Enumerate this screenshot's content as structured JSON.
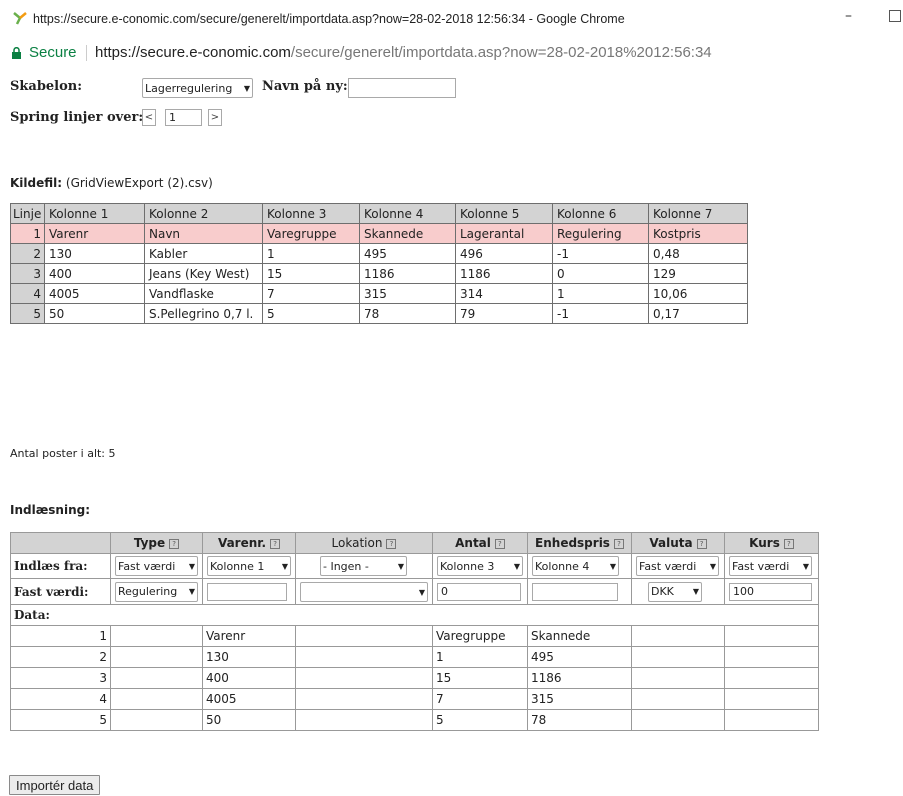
{
  "window": {
    "title": "https://secure.e-conomic.com/secure/generelt/importdata.asp?now=28-02-2018 12:56:34 - Google Chrome",
    "minimize": "–"
  },
  "address": {
    "secure_label": "Secure",
    "url_host": "https://secure.e-conomic.com",
    "url_path": "/secure/generelt/importdata.asp?now=28-02-2018%2012:56:34"
  },
  "form": {
    "template_label": "Skabelon:",
    "template_value": "Lagerregulering",
    "new_name_label": "Navn på ny:",
    "new_name_value": "",
    "skip_label": "Spring linjer over:",
    "skip_prev": "<",
    "skip_value": "1",
    "skip_next": ">"
  },
  "source": {
    "label": "Kildefil:",
    "filename": "(GridViewExport (2).csv)",
    "headers": [
      "Linje",
      "Kolonne 1",
      "Kolonne 2",
      "Kolonne 3",
      "Kolonne 4",
      "Kolonne 5",
      "Kolonne 6",
      "Kolonne 7"
    ],
    "rows": [
      [
        "1",
        "Varenr",
        "Navn",
        "Varegruppe",
        "Skannede",
        "Lagerantal",
        "Regulering",
        "Kostpris"
      ],
      [
        "2",
        "130",
        "Kabler",
        "1",
        "495",
        "496",
        "-1",
        "0,48"
      ],
      [
        "3",
        "400",
        "Jeans (Key West)",
        "15",
        "1186",
        "1186",
        "0",
        "129"
      ],
      [
        "4",
        "4005",
        "Vandflaske",
        "7",
        "315",
        "314",
        "1",
        "10,06"
      ],
      [
        "5",
        "50",
        "S.Pellegrino 0,7 l.",
        "5",
        "78",
        "79",
        "-1",
        "0,17"
      ]
    ],
    "total": "Antal poster i alt: 5"
  },
  "import": {
    "title": "Indlæsning:",
    "headers": [
      "Type",
      "Varenr.",
      "Lokation",
      "Antal",
      "Enhedspris",
      "Valuta",
      "Kurs"
    ],
    "read_from_label": "Indlæs fra:",
    "read_from": [
      "Fast værdi",
      "Kolonne 1",
      "- Ingen -",
      "Kolonne 3",
      "Kolonne 4",
      "Fast værdi",
      "Fast værdi"
    ],
    "fixed_label": "Fast værdi:",
    "fixed_type": "Regulering",
    "fixed_varenr": "",
    "fixed_lokation": "",
    "fixed_antal": "0",
    "fixed_enhedspris": "",
    "fixed_valuta": "DKK",
    "fixed_kurs": "100",
    "data_label": "Data:",
    "data_rows": [
      [
        "1",
        "",
        "Varenr",
        "",
        "Varegruppe",
        "Skannede",
        "",
        ""
      ],
      [
        "2",
        "",
        "130",
        "",
        "1",
        "495",
        "",
        ""
      ],
      [
        "3",
        "",
        "400",
        "",
        "15",
        "1186",
        "",
        ""
      ],
      [
        "4",
        "",
        "4005",
        "",
        "7",
        "315",
        "",
        ""
      ],
      [
        "5",
        "",
        "50",
        "",
        "5",
        "78",
        "",
        ""
      ]
    ],
    "button_label": "Importér data"
  }
}
